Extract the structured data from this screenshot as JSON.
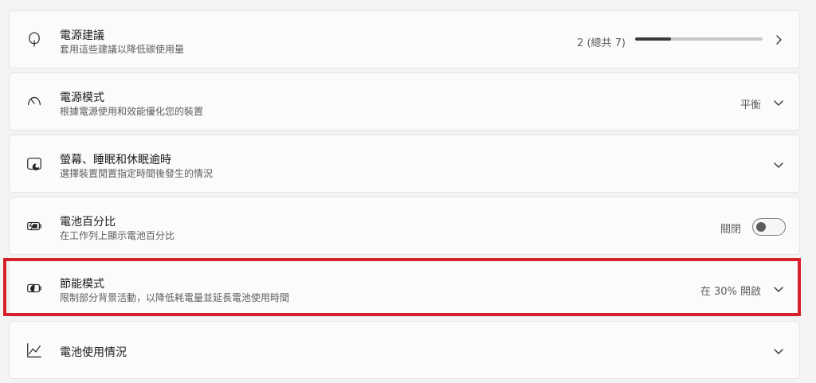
{
  "rows": [
    {
      "icon": "leaf-icon",
      "title": "電源建議",
      "subtitle": "套用這些建議以降低碳使用量",
      "status": "2 (總共 7)",
      "progress": 0.28
    },
    {
      "icon": "speedometer-icon",
      "title": "電源模式",
      "subtitle": "根據電源使用和效能優化您的裝置",
      "value": "平衡"
    },
    {
      "icon": "screen-sleep-icon",
      "title": "螢幕、睡眠和休眠逾時",
      "subtitle": "選擇裝置閒置指定時間後發生的情況"
    },
    {
      "icon": "battery-charging-icon",
      "title": "電池百分比",
      "subtitle": "在工作列上顯示電池百分比",
      "toggle_label": "關閉",
      "toggle_on": false
    },
    {
      "icon": "battery-saver-icon",
      "title": "節能模式",
      "subtitle": "限制部分背景活動，以降低耗電量並延長電池使用時間",
      "value": "在 30% 開啟"
    },
    {
      "icon": "line-chart-icon",
      "title": "電池使用情況"
    }
  ],
  "highlight_color": "#d6202b"
}
